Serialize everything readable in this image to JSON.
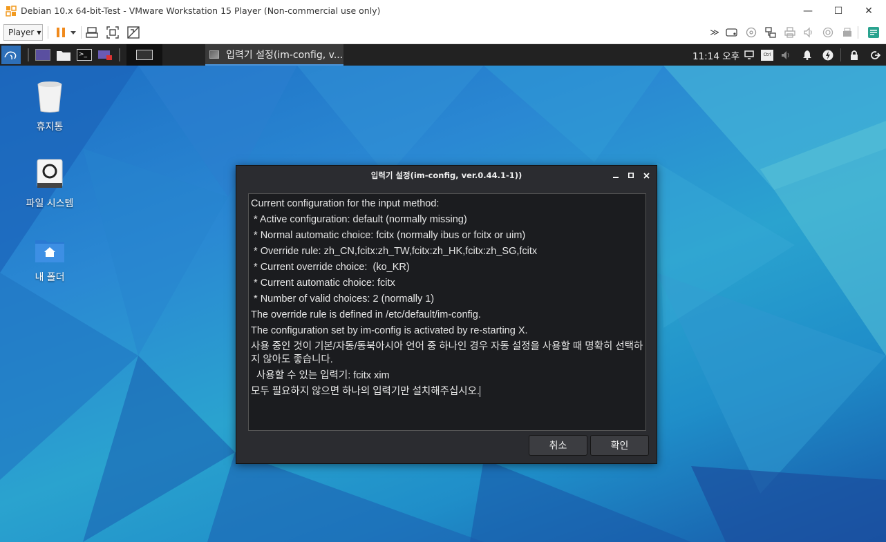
{
  "vm": {
    "title": "Debian 10.x 64-bit-Test - VMware Workstation 15 Player (Non-commercial use only)",
    "player_label": "Player",
    "window_controls": {
      "minimize": "—",
      "maximize": "☐",
      "close": "✕"
    }
  },
  "panel": {
    "task_title": "입력기 설정(im-config, v...",
    "clock": "11:14 오후"
  },
  "desktop": {
    "icons": [
      {
        "label": "휴지통"
      },
      {
        "label": "파일 시스템"
      },
      {
        "label": "내 폴더"
      }
    ]
  },
  "dialog": {
    "title": "입력기 설정(im-config, ver.0.44.1-1))",
    "lines": [
      "Current configuration for the input method:",
      " * Active configuration: default (normally missing)",
      " * Normal automatic choice: fcitx (normally ibus or fcitx or uim)",
      " * Override rule: zh_CN,fcitx:zh_TW,fcitx:zh_HK,fcitx:zh_SG,fcitx",
      " * Current override choice:  (ko_KR)",
      " * Current automatic choice: fcitx",
      " * Number of valid choices: 2 (normally 1)",
      "The override rule is defined in /etc/default/im-config.",
      "The configuration set by im-config is activated by re-starting X."
    ],
    "wrapped_line": "사용 중인 것이 기본/자동/동북아시아 언어 중 하나인 경우 자동 설정을 사용할 때 명확히 선택하지 않아도 좋습니다.",
    "available_line": "  사용할 수 있는 입력기: fcitx xim",
    "last_line": "모두 필요하지 않으면 하나의 입력기만 설치해주십시오.",
    "cancel_label": "취소",
    "ok_label": "확인"
  },
  "colors": {
    "panel_bg": "#222222",
    "dialog_bg": "#2b2c30",
    "accent": "#4d94d8"
  }
}
